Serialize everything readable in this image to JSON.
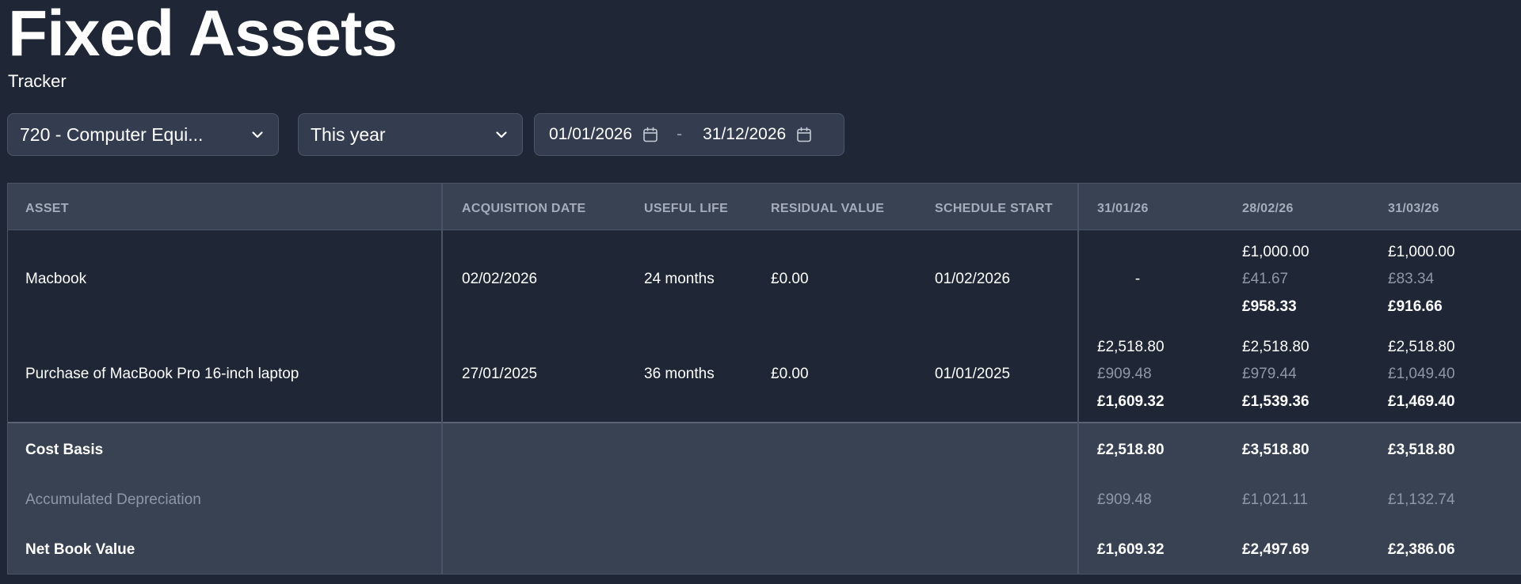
{
  "page": {
    "title": "Fixed Assets",
    "subtitle": "Tracker"
  },
  "filters": {
    "account": "720 - Computer Equi...",
    "period": "This year",
    "date_from": "01/01/2026",
    "date_separator": "-",
    "date_to": "31/12/2026"
  },
  "table": {
    "columns": [
      "ASSET",
      "ACQUISITION DATE",
      "USEFUL LIFE",
      "RESIDUAL VALUE",
      "SCHEDULE START",
      "31/01/26",
      "28/02/26",
      "31/03/26"
    ],
    "rows": [
      {
        "asset": "Macbook",
        "acquisition_date": "02/02/2026",
        "useful_life": "24 months",
        "residual_value": "£0.00",
        "schedule_start": "01/02/2026",
        "periods": [
          {
            "empty": "-"
          },
          {
            "cost": "£1,000.00",
            "depreciation": "£41.67",
            "nbv": "£958.33"
          },
          {
            "cost": "£1,000.00",
            "depreciation": "£83.34",
            "nbv": "£916.66"
          }
        ]
      },
      {
        "asset": "Purchase of MacBook Pro 16-inch laptop",
        "acquisition_date": "27/01/2025",
        "useful_life": "36 months",
        "residual_value": "£0.00",
        "schedule_start": "01/01/2025",
        "periods": [
          {
            "cost": "£2,518.80",
            "depreciation": "£909.48",
            "nbv": "£1,609.32"
          },
          {
            "cost": "£2,518.80",
            "depreciation": "£979.44",
            "nbv": "£1,539.36"
          },
          {
            "cost": "£2,518.80",
            "depreciation": "£1,049.40",
            "nbv": "£1,469.40"
          }
        ]
      }
    ],
    "totals": [
      {
        "label": "Cost Basis",
        "values": [
          "£2,518.80",
          "£3,518.80",
          "£3,518.80"
        ]
      },
      {
        "label": "Accumulated Depreciation",
        "values": [
          "£909.48",
          "£1,021.11",
          "£1,132.74"
        ]
      },
      {
        "label": "Net Book Value",
        "values": [
          "£1,609.32",
          "£2,497.69",
          "£2,386.06"
        ]
      }
    ]
  },
  "icons": {
    "dropdown": "chevron-down-icon",
    "calendar": "calendar-icon"
  },
  "colors": {
    "background": "#1f2736",
    "header": "#384253",
    "muted_text": "#8e97a6",
    "border": "#4a5567"
  }
}
